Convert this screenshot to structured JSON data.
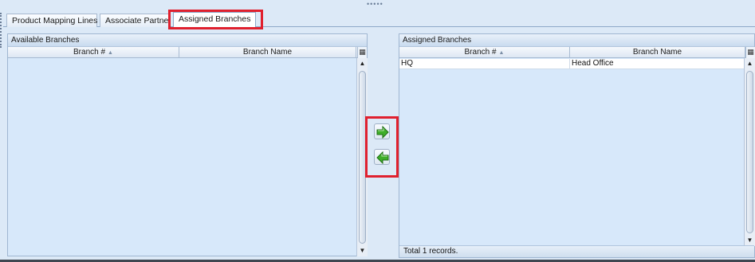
{
  "tabs": [
    {
      "label": "Product Mapping Lines",
      "active": false
    },
    {
      "label": "Associate Partner",
      "active": false
    },
    {
      "label": "Assigned Branches",
      "active": true
    }
  ],
  "available": {
    "title": "Available Branches",
    "columns": [
      "Branch #",
      "Branch Name"
    ],
    "sort_glyph": "▲",
    "column_chooser": "▦",
    "rows": []
  },
  "assigned": {
    "title": "Assigned Branches",
    "columns": [
      "Branch #",
      "Branch Name"
    ],
    "sort_glyph": "▲",
    "column_chooser": "▦",
    "rows": [
      {
        "branch_no": "HQ",
        "branch_name": "Head Office"
      }
    ],
    "footer": "Total 1 records."
  },
  "scroll_arrows": {
    "up": "▲",
    "down": "▼"
  },
  "drag_handle": "•••••",
  "icons": {
    "move_right": "green-right-arrow-icon",
    "move_left": "green-left-arrow-icon"
  },
  "colors": {
    "highlight": "#e0202e",
    "panel_bg": "#d7e8fa",
    "arrow_green": "#3fae2a"
  }
}
